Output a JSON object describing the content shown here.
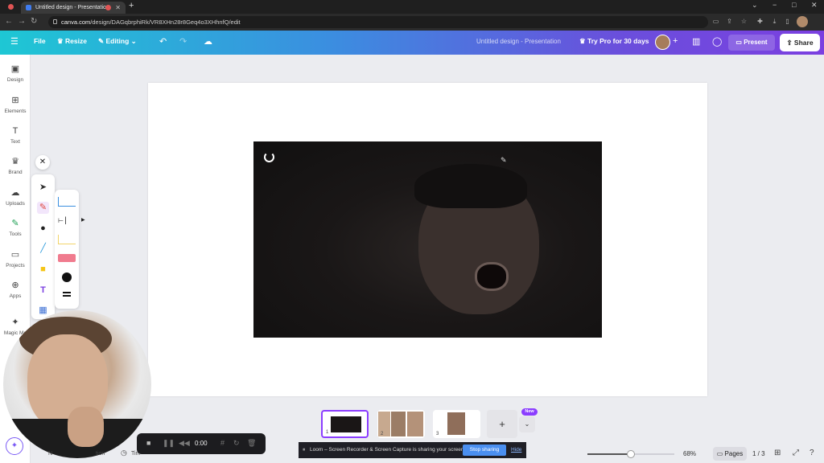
{
  "browser": {
    "tab_title": "Untitled design - Presentatio",
    "url_host": "canva.com",
    "url_path": "/design/DAGqbrphiRk/VR8XHn28r8Geq4o3XHhnfQ/edit",
    "new_tab": "+",
    "min": "⌄",
    "minimize": "−",
    "restore": "□",
    "close": "✕"
  },
  "header": {
    "menu_icon": "☰",
    "file": "File",
    "resize": "Resize",
    "editing": "Editing",
    "doc_title": "Untitled design - Presentation",
    "try_pro": "Try Pro for 30 days",
    "present": "Present",
    "share": "Share"
  },
  "sidebar": {
    "items": [
      {
        "label": "Design",
        "icon": "▣"
      },
      {
        "label": "Elements",
        "icon": "⊞"
      },
      {
        "label": "Text",
        "icon": "T"
      },
      {
        "label": "Brand",
        "icon": "♛"
      },
      {
        "label": "Uploads",
        "icon": "☁"
      },
      {
        "label": "Tools",
        "icon": "✎"
      },
      {
        "label": "Projects",
        "icon": "▭"
      },
      {
        "label": "Apps",
        "icon": "⊕"
      },
      {
        "label": "Magic Me",
        "icon": "✦"
      }
    ]
  },
  "recording": {
    "time": "0:00"
  },
  "pages": {
    "thumbnails": [
      "1",
      "2",
      "3"
    ],
    "add": "+",
    "new_badge": "New",
    "pages_label": "Pages",
    "count": "1 / 3"
  },
  "zoom": {
    "level": "68%",
    "value": 0.5
  },
  "bottom_left": {
    "notes": "N",
    "duration": "tion",
    "timer": "Tim"
  },
  "loom": {
    "message": "Loom – Screen Recorder & Screen Capture is sharing your screen.",
    "stop": "Stop sharing",
    "hide": "Hide"
  },
  "colors": {
    "accent": "#8b3dff",
    "header_start": "#1ec7d4",
    "header_end": "#7b3fe0"
  }
}
